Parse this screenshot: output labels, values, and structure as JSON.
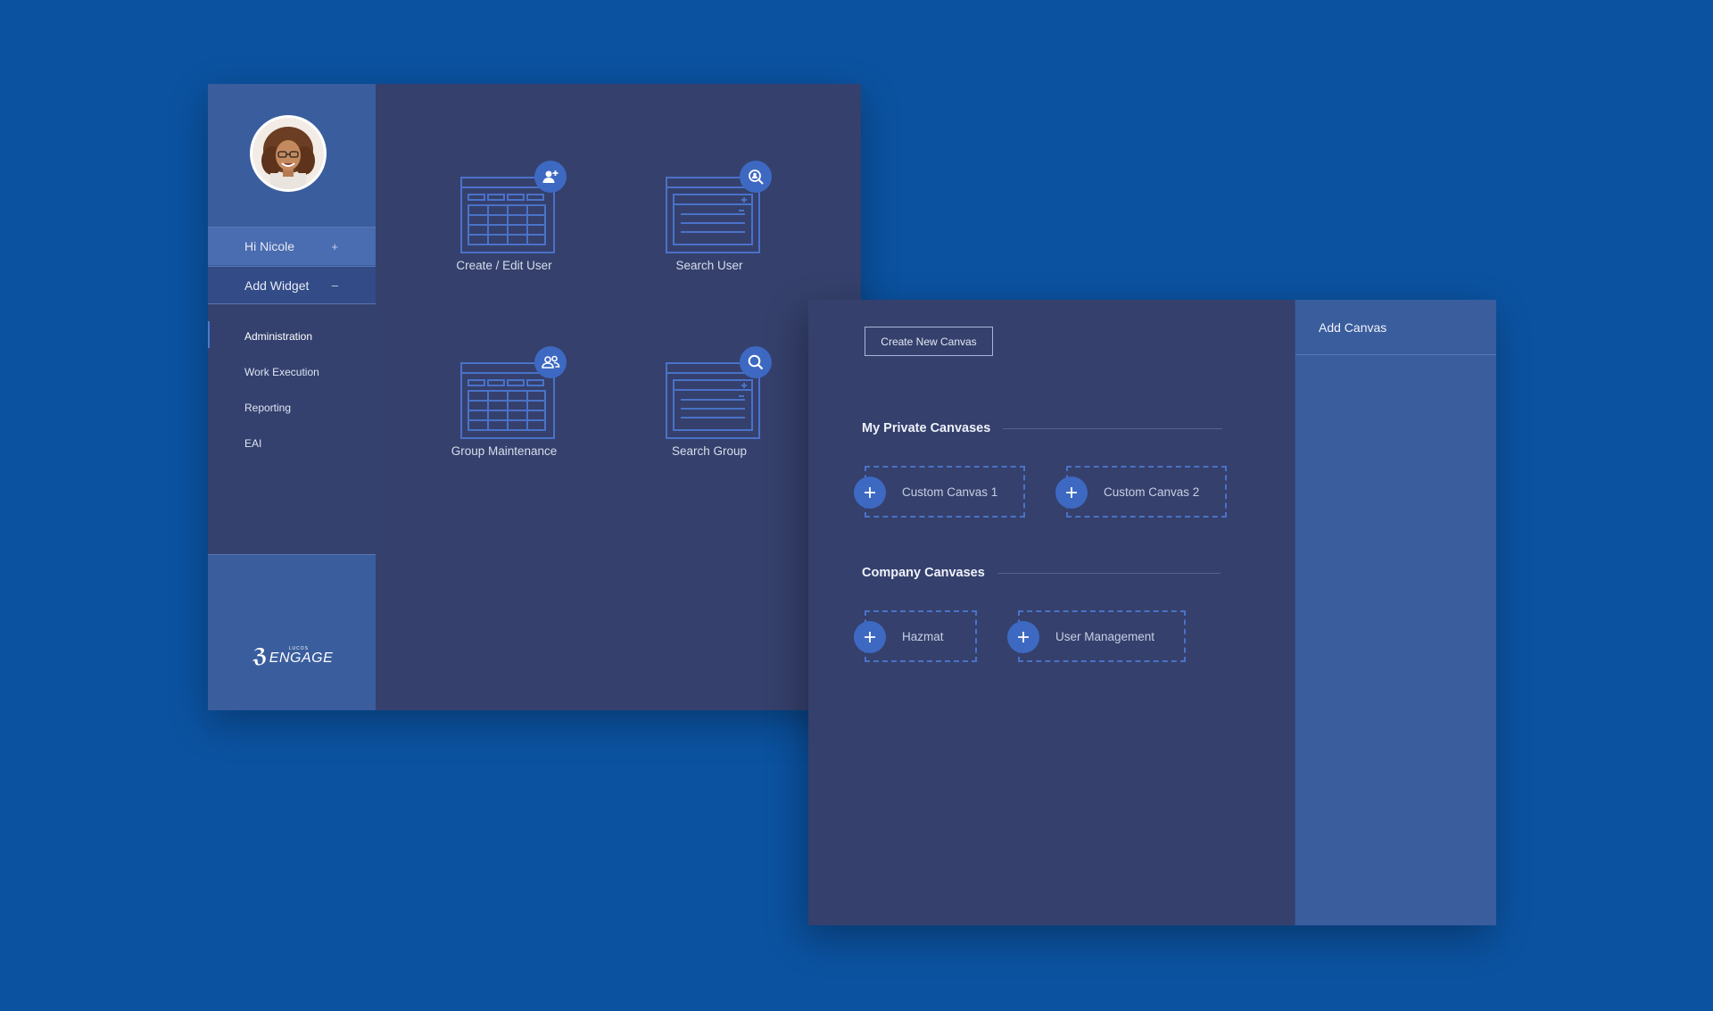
{
  "user_panel": {
    "greeting": "Hi Nicole",
    "greeting_toggle": "+",
    "add_widget": "Add Widget",
    "add_widget_toggle": "–",
    "nav": [
      {
        "label": "Administration",
        "active": true
      },
      {
        "label": "Work Execution",
        "active": false
      },
      {
        "label": "Reporting",
        "active": false
      },
      {
        "label": "EAI",
        "active": false
      }
    ],
    "logo": {
      "small": "LUCOS",
      "word": "ENGAGE"
    }
  },
  "widgets": [
    {
      "label": "Create / Edit User",
      "icon": "table-window-icon",
      "badge_icon": "add-user-icon"
    },
    {
      "label": "Search User",
      "icon": "form-window-icon",
      "badge_icon": "search-user-icon"
    },
    {
      "label": "Group Maintenance",
      "icon": "table-window-icon",
      "badge_icon": "group-icon"
    },
    {
      "label": "Search Group",
      "icon": "form-window-icon",
      "badge_icon": "search-icon"
    }
  ],
  "canvas_panel": {
    "create_button": "Create New Canvas",
    "private_title": "My Private Canvases",
    "private_canvases": [
      "Custom Canvas 1",
      "Custom Canvas 2"
    ],
    "company_title": "Company Canvases",
    "company_canvases": [
      "Hazmat",
      "User Management"
    ],
    "side_title": "Add Canvas"
  },
  "colors": {
    "background": "#0b52a0",
    "sidebar": "#3a5d9d",
    "panel": "#35406c",
    "accent": "#3d69c2",
    "dashed_border": "#4a72c8"
  }
}
